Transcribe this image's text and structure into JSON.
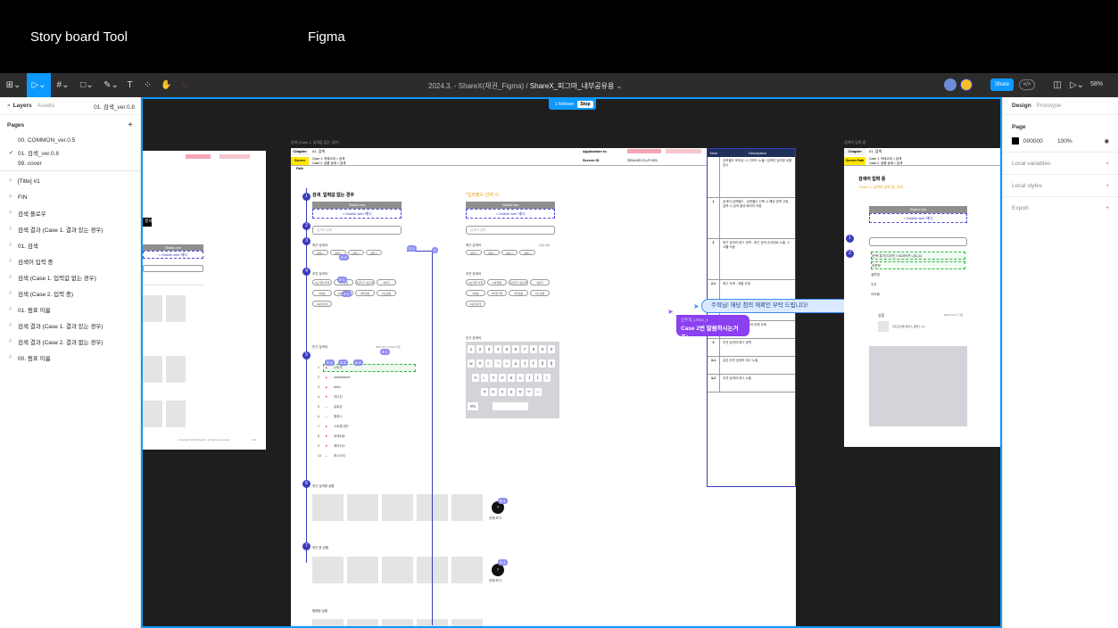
{
  "captions": {
    "left": "Story board Tool",
    "right": "Figma"
  },
  "toolbar": {
    "file_name": "2024.3. - ShareX(채권_Figma)",
    "separator": "/",
    "project": "ShareX_피그마_내부공유용",
    "share_label": "Share",
    "zoom": "58%",
    "follower": "1 follower",
    "stop": "Stop"
  },
  "left_panel": {
    "tab_layers": "Layers",
    "tab_assets": "Assets",
    "page_selector": "01. 검색_ver.0.8",
    "pages_title": "Pages",
    "pages": [
      {
        "label": "00. COMMON_ver.0.5",
        "check": ""
      },
      {
        "label": "01. 검색_ver.0.8",
        "check": "✓"
      },
      {
        "label": "99. cover",
        "check": ""
      }
    ],
    "layers": [
      "[Title] #1",
      "FIN",
      "검색 플로우",
      "검색 결과 (Case 1. 결과 있는 경우)",
      "01. 검색",
      "검색어 입력 중",
      "검색 (Case 1. 입력값 없는 경우)",
      "검색 (Case 2. 입력 중)",
      "01. 찜표 이름",
      "검색 결과 (Case 1. 결과 있는 경우)",
      "검색 결과 (Case 2. 결과 없는 경우)",
      "00. 찜표 이름"
    ]
  },
  "right_panel": {
    "tab_design": "Design",
    "tab_prototype": "Prototype",
    "page_title": "Page",
    "color_hex": "000000",
    "opacity": "100%",
    "sections": [
      "Local variables",
      "Local styles",
      "Export"
    ]
  },
  "canvas": {
    "left_partial": {
      "title": "결과",
      "status": "Status bar",
      "mobile_header": "< Mobile web 헤더",
      "copyright": "Copyright 2023 ShareX. All rights reserved.",
      "pagenum": "1of1"
    },
    "main_frame": {
      "label": "검색 (Case 1. 입력값 없는 경우)",
      "chapter_label": "Chapter",
      "chapter_value": "01. 검색",
      "path_label": "Screen Path",
      "path_value_1": "Case 1. 카테고리 > 검색",
      "path_value_2": "Case 2. 상품 상세 > 검색",
      "app_label": "Application to",
      "screen_label": "Screen ID",
      "screen_value": "SEA-MO-S-LP-001",
      "section_title": "검색_입력값 없는 경우",
      "alt_title": "*입력필드 선택 시",
      "status": "Status bar",
      "mobile_header": "< Mobile web 헤더",
      "search_placeholder": "검색어 입력",
      "recent_title": "최근 검색어",
      "delete_all": "전체 삭제",
      "recent_tags": [
        "경력 ×",
        "경력 ×",
        "경력 ×",
        "경력 ×"
      ],
      "recommended_title": "추천 검색어",
      "recommended_pills": [
        "#초겨울 어택",
        "#여행템",
        "#갑자기 필요해",
        "#뷰티",
        "#배송",
        "#여행가방",
        "#화장품",
        "#신상품",
        "#공정하게"
      ],
      "popular_title": "인기 검색어",
      "popular_time": "2023.10.1 13:00 기준",
      "popular_rows": [
        {
          "rank": "1",
          "arrow": "▲",
          "word": "니트가"
        },
        {
          "rank": "2",
          "arrow": "▲",
          "word": "newbalance"
        },
        {
          "rank": "3",
          "arrow": "▲",
          "word": "airbo"
        },
        {
          "rank": "4",
          "arrow": "▼",
          "word": "카디건"
        },
        {
          "rank": "5",
          "arrow": "—",
          "word": "살로몬"
        },
        {
          "rank": "6",
          "arrow": "—",
          "word": "원피스"
        },
        {
          "rank": "7",
          "arrow": "▲",
          "word": "스트랩 샌드"
        },
        {
          "rank": "8",
          "arrow": "▼",
          "word": "후레쉬요"
        },
        {
          "rank": "9",
          "arrow": "▼",
          "word": "에이지스"
        },
        {
          "rank": "10",
          "arrow": "—",
          "word": "머스티지"
        }
      ],
      "recent_products_title": "최근 검색한 상품",
      "viewed_products_title": "최근 본 상품",
      "more_label": "전체 보기",
      "favorites_title": "찜해둔 상품",
      "keyboard": {
        "numbers": [
          "1",
          "2",
          "3",
          "4",
          "5",
          "6",
          "7",
          "8",
          "9",
          "0"
        ],
        "row1": [
          "ㅂ",
          "ㅈ",
          "ㄷ",
          "ㄱ",
          "ㅅ",
          "ㅛ",
          "ㅕ",
          "ㅑ",
          "ㅐ",
          "ㅔ"
        ],
        "row2": [
          "ㅁ",
          "ㄴ",
          "ㅇ",
          "ㄹ",
          "ㅎ",
          "ㅗ",
          "ㅓ",
          "ㅏ",
          "ㅣ"
        ],
        "row3": [
          "ㅋ",
          "ㅌ",
          "ㅊ",
          "ㅍ",
          "ㅠ",
          "ㅜ",
          "ㅡ"
        ],
        "special": "!#1"
      },
      "badges": [
        "1",
        "2",
        "3",
        "4",
        "5",
        "6",
        "7"
      ],
      "sub_badges": [
        "2-1",
        "2-2",
        "3-1",
        "3-2",
        "4-1",
        "4-2",
        "4-3",
        "4-4",
        "5-1",
        "6-1",
        "A"
      ],
      "desc_header_num": "Num",
      "desc_header_desc": "Description",
      "desc_rows": [
        {
          "num": "",
          "text": "입력필드 포커싱 시, 키보드 노출 / 입력란 입력된 내용 표시"
        },
        {
          "num": "1",
          "text": "검색어 입력필드 - 입력필드 선택 시 해당 영역 고정, 입력 시 검색 결과 페이지 이동"
        },
        {
          "num": "2",
          "text": "최근 검색어 태그 영역 - 최근 검색 순서대로 노출, 스크롤 이동"
        },
        {
          "num": "2-1",
          "text": "태그 삭제 - 개별 삭제"
        },
        {
          "num": "2-2",
          "text": "전체 삭제 - 최근 검색어 전체 삭제"
        },
        {
          "num": "3",
          "text": "추천 검색어 태그 영역"
        },
        {
          "num": "3-1",
          "text": "같은 추천 검색어 태그 노출"
        },
        {
          "num": "3-2",
          "text": "추천 검색어 태그 노출"
        }
      ]
    },
    "right_frame": {
      "label": "검색어 입력 중",
      "chapter_label": "Chapter",
      "chapter_value": "01. 검색",
      "path_label": "Screen Path",
      "path_value_1": "Case 1. 카테고리 > 검색",
      "path_value_2": "Case 2. 상품 상세 > 검색",
      "section_title": "검색어 입력 중",
      "subtitle": "*Case 1. 검색어 입력 중_초성",
      "status": "Status bar",
      "mobile_header": "< Mobile web 헤더",
      "suggest_items": [
        "[단독 특가] 디자인 스트라이프 니트 (1)",
        "아웃렛",
        "셀루엣",
        "무신",
        "아이템"
      ],
      "product_title": "상품",
      "product_date": "2023.10.01 기준",
      "product_name": "마드모아젤 레이스 원피스 (1)"
    },
    "cursor_chip": {
      "user": "민주희_UXUI_1",
      "message": "Case 2번 말씀하시는거죠!"
    },
    "comment": {
      "text": "주혁님! 해당 첨의 재확인 부탁 드립니다!"
    }
  }
}
